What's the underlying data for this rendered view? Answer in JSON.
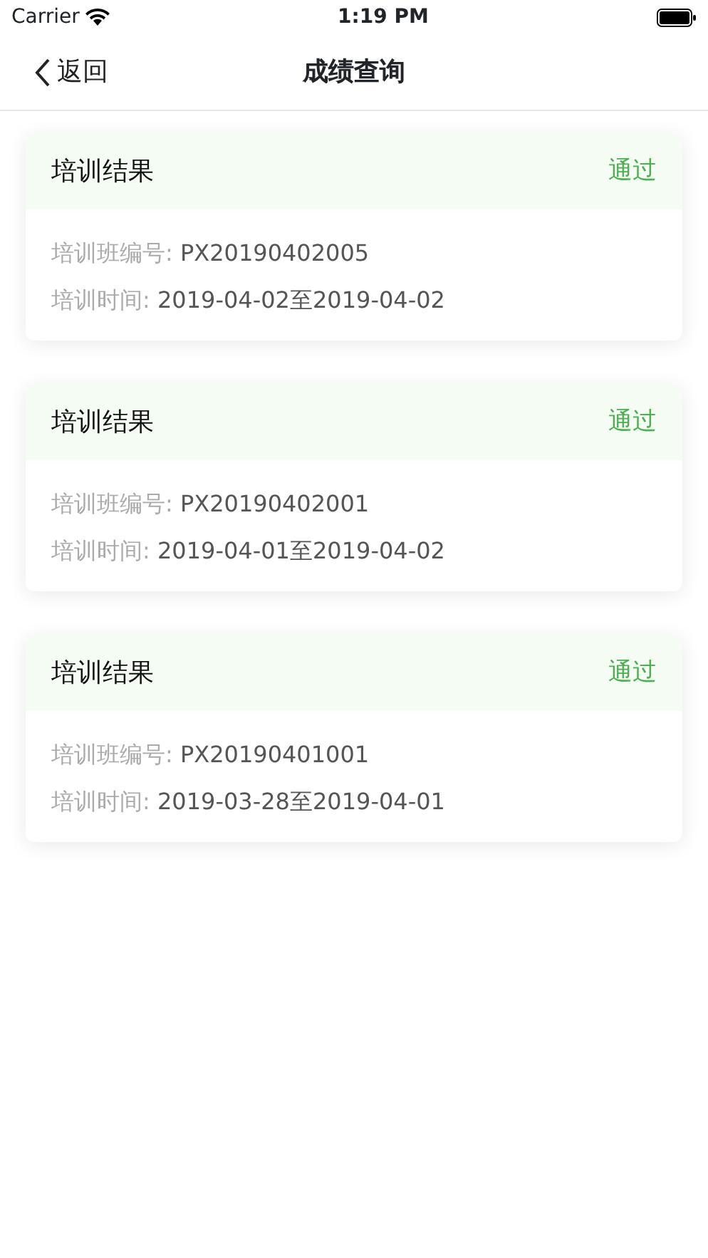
{
  "status_bar": {
    "carrier": "Carrier",
    "time": "1:19 PM"
  },
  "nav_bar": {
    "back": "返回",
    "title": "成绩查询"
  },
  "results": [
    {
      "title": "培训结果",
      "status": "通过",
      "fields": [
        {
          "label": "培训班编号:",
          "value": "PX20190402005"
        },
        {
          "label": "培训时间:",
          "value": "2019-04-02至2019-04-02"
        }
      ]
    },
    {
      "title": "培训结果",
      "status": "通过",
      "fields": [
        {
          "label": "培训班编号:",
          "value": "PX20190402001"
        },
        {
          "label": "培训时间:",
          "value": "2019-04-01至2019-04-02"
        }
      ]
    },
    {
      "title": "培训结果",
      "status": "通过",
      "fields": [
        {
          "label": "培训班编号:",
          "value": "PX20190401001"
        },
        {
          "label": "培训时间:",
          "value": "2019-03-28至2019-04-01"
        }
      ]
    }
  ]
}
